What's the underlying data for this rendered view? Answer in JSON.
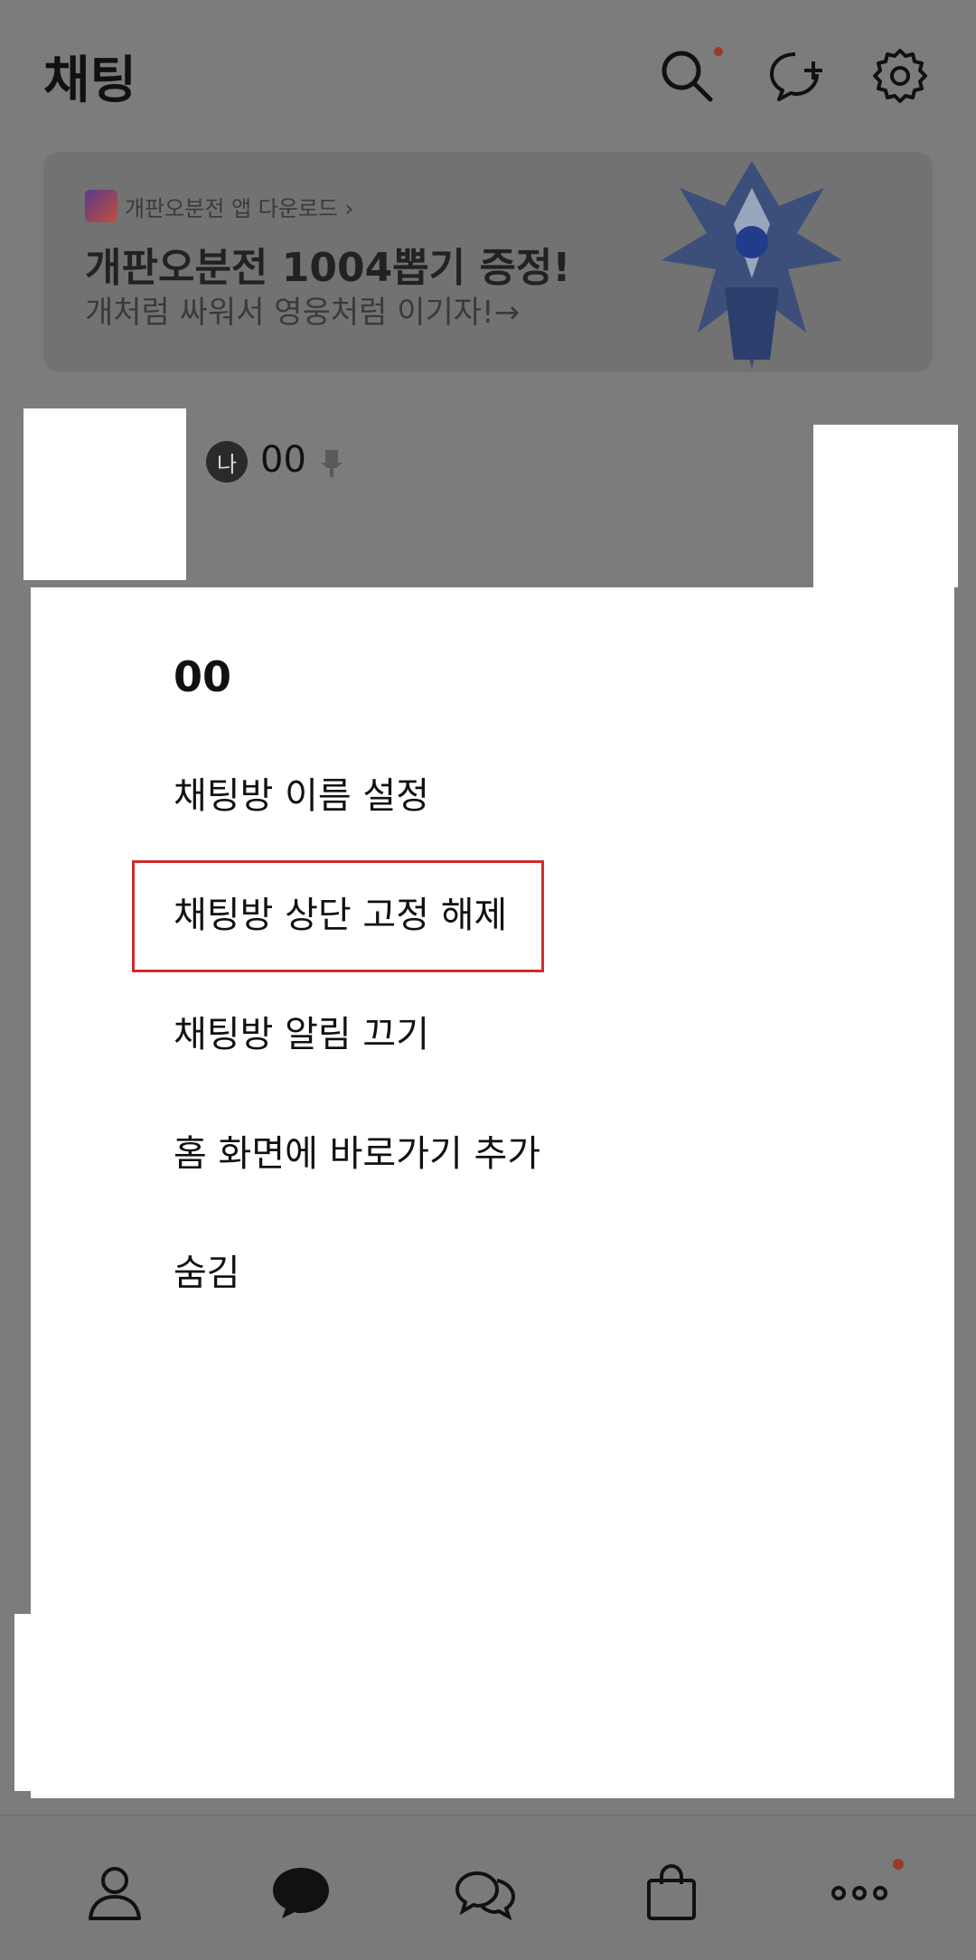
{
  "header": {
    "title": "채팅",
    "icons": [
      "search-icon",
      "new-chat-icon",
      "settings-icon"
    ]
  },
  "banner": {
    "sponsor": "개판오분전 앱 다운로드 ›",
    "headline": "개판오분전 1004뽑기 증정!",
    "subline": "개처럼 싸워서 영웅처럼 이기자!→"
  },
  "chat": {
    "me_badge": "나",
    "name": "00"
  },
  "menu": {
    "title": "00",
    "items": [
      "채팅방 이름 설정",
      "채팅방 상단 고정 해제",
      "채팅방 알림 끄기",
      "홈 화면에 바로가기 추가",
      "숨김"
    ]
  },
  "bottom_nav": {
    "items": [
      "friends-icon",
      "chats-icon",
      "openchat-icon",
      "shopping-icon",
      "more-icon"
    ],
    "active": "chats-icon"
  },
  "colors": {
    "highlight": "#d22b2b",
    "notification_dot": "#9a3a2a"
  }
}
